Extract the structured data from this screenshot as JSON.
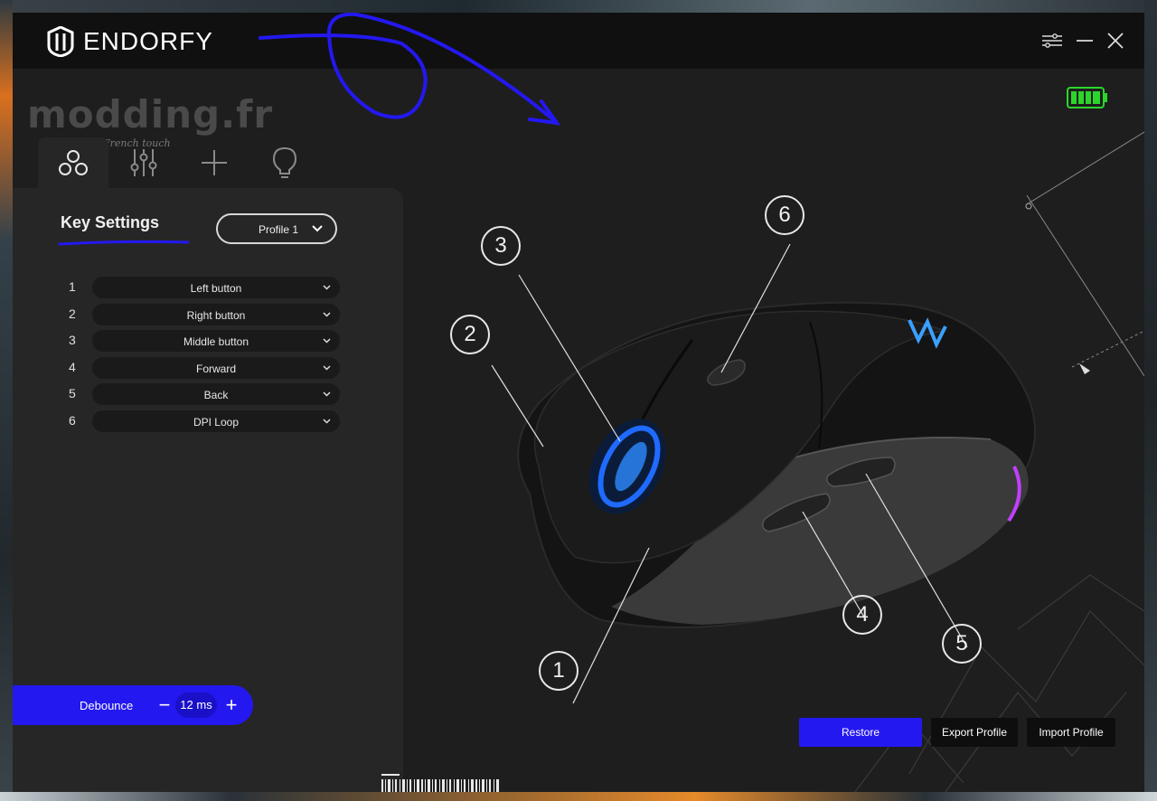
{
  "app": {
    "brand": "ENDORFY"
  },
  "watermark": {
    "text": "modding.fr",
    "tagline": "French touch"
  },
  "tabs": [
    {
      "name": "keys",
      "icon": "three-circles-icon",
      "active": true
    },
    {
      "name": "performance",
      "icon": "sliders-icon",
      "active": false
    },
    {
      "name": "macro",
      "icon": "plus-icon",
      "active": false
    },
    {
      "name": "lighting",
      "icon": "lightbulb-icon",
      "active": false
    }
  ],
  "panel": {
    "title": "Key Settings",
    "profile": "Profile 1",
    "keys": [
      {
        "num": "1",
        "action": "Left button"
      },
      {
        "num": "2",
        "action": "Right button"
      },
      {
        "num": "3",
        "action": "Middle button"
      },
      {
        "num": "4",
        "action": "Forward"
      },
      {
        "num": "5",
        "action": "Back"
      },
      {
        "num": "6",
        "action": "DPI Loop"
      }
    ],
    "debounce": {
      "label": "Debounce",
      "value": "12 ms",
      "minus": "−",
      "plus": "+"
    }
  },
  "callouts": [
    "1",
    "2",
    "3",
    "4",
    "5",
    "6"
  ],
  "actions": {
    "restore": "Restore",
    "export": "Export Profile",
    "import": "Import Profile"
  },
  "colors": {
    "accent": "#2418f0",
    "battery": "#2bd62b",
    "background": "#1e1e1e",
    "panel": "#262626"
  }
}
